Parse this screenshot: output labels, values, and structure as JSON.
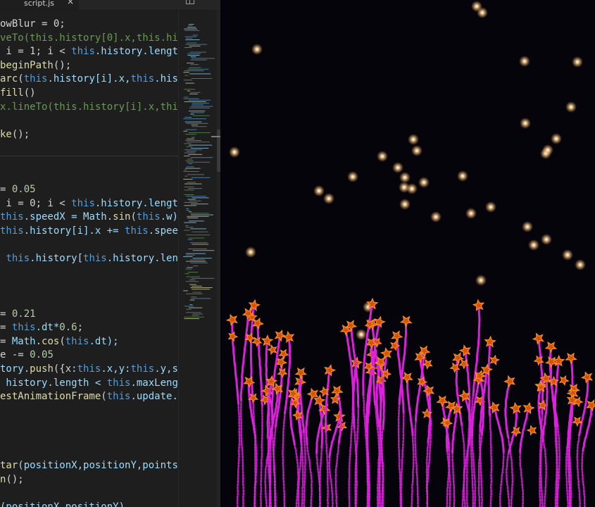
{
  "editor": {
    "tab": {
      "label": "script.js",
      "close_glyph": "×"
    },
    "code_lines": [
      [
        {
          "t": "owBlur = 0;",
          "c": "tk-op"
        }
      ],
      [
        {
          "t": "veTo",
          "c": "tk-cm"
        },
        {
          "t": "(this.history[0].x,this.hi",
          "c": "tk-cm"
        }
      ],
      [
        {
          "t": " i = 1; i < ",
          "c": "tk-op"
        },
        {
          "t": "this",
          "c": "tk-kw"
        },
        {
          "t": ".history.lengt",
          "c": "tk-prop"
        }
      ],
      [
        {
          "t": "beginPath",
          "c": "tk-fn"
        },
        {
          "t": "();",
          "c": "tk-op"
        }
      ],
      [
        {
          "t": "arc",
          "c": "tk-fn"
        },
        {
          "t": "(",
          "c": "tk-op"
        },
        {
          "t": "this",
          "c": "tk-kw"
        },
        {
          "t": ".history[i].x,",
          "c": "tk-prop"
        },
        {
          "t": "this",
          "c": "tk-kw"
        },
        {
          "t": ".his",
          "c": "tk-prop"
        }
      ],
      [
        {
          "t": "fill",
          "c": "tk-fn"
        },
        {
          "t": "()",
          "c": "tk-op"
        }
      ],
      [
        {
          "t": "x.lineTo(this.history[i].x,thi",
          "c": "tk-cm"
        }
      ],
      [
        {
          "t": "",
          "c": "tk-op"
        }
      ],
      [
        {
          "t": "ke",
          "c": "tk-fn"
        },
        {
          "t": "();",
          "c": "tk-op"
        }
      ],
      [
        {
          "t": "",
          "c": "tk-op"
        }
      ],
      [
        {
          "t": "",
          "c": "tk-op"
        }
      ],
      [
        {
          "t": "",
          "c": "tk-op"
        }
      ],
      [
        {
          "t": "= ",
          "c": "tk-op"
        },
        {
          "t": "0.05",
          "c": "tk-num"
        }
      ],
      [
        {
          "t": " i = 0; i < ",
          "c": "tk-op"
        },
        {
          "t": "this",
          "c": "tk-kw"
        },
        {
          "t": ".history.lengt",
          "c": "tk-prop"
        }
      ],
      [
        {
          "t": "this",
          "c": "tk-kw"
        },
        {
          "t": ".speedX = ",
          "c": "tk-prop"
        },
        {
          "t": "Math",
          "c": "tk-prop"
        },
        {
          "t": ".",
          "c": "tk-op"
        },
        {
          "t": "sin",
          "c": "tk-fn"
        },
        {
          "t": "(",
          "c": "tk-op"
        },
        {
          "t": "this",
          "c": "tk-kw"
        },
        {
          "t": ".w)",
          "c": "tk-prop"
        }
      ],
      [
        {
          "t": "this",
          "c": "tk-kw"
        },
        {
          "t": ".history[i].x += ",
          "c": "tk-prop"
        },
        {
          "t": "this",
          "c": "tk-kw"
        },
        {
          "t": ".spee",
          "c": "tk-prop"
        }
      ],
      [
        {
          "t": "",
          "c": "tk-op"
        }
      ],
      [
        {
          "t": " ",
          "c": "tk-op"
        },
        {
          "t": "this",
          "c": "tk-kw"
        },
        {
          "t": ".history[",
          "c": "tk-prop"
        },
        {
          "t": "this",
          "c": "tk-kw"
        },
        {
          "t": ".history.len",
          "c": "tk-prop"
        }
      ],
      [
        {
          "t": "",
          "c": "tk-op"
        }
      ],
      [
        {
          "t": "",
          "c": "tk-op"
        }
      ],
      [
        {
          "t": "",
          "c": "tk-op"
        }
      ],
      [
        {
          "t": "= ",
          "c": "tk-op"
        },
        {
          "t": "0.21",
          "c": "tk-num"
        }
      ],
      [
        {
          "t": "= ",
          "c": "tk-op"
        },
        {
          "t": "this",
          "c": "tk-kw"
        },
        {
          "t": ".dt*",
          "c": "tk-prop"
        },
        {
          "t": "0.6",
          "c": "tk-num"
        },
        {
          "t": ";",
          "c": "tk-op"
        }
      ],
      [
        {
          "t": "= ",
          "c": "tk-op"
        },
        {
          "t": "Math",
          "c": "tk-prop"
        },
        {
          "t": ".",
          "c": "tk-op"
        },
        {
          "t": "cos",
          "c": "tk-fn"
        },
        {
          "t": "(",
          "c": "tk-op"
        },
        {
          "t": "this",
          "c": "tk-kw"
        },
        {
          "t": ".dt);",
          "c": "tk-prop"
        }
      ],
      [
        {
          "t": "e -= ",
          "c": "tk-op"
        },
        {
          "t": "0.05",
          "c": "tk-num"
        }
      ],
      [
        {
          "t": "tory.",
          "c": "tk-prop"
        },
        {
          "t": "push",
          "c": "tk-fn"
        },
        {
          "t": "({x:",
          "c": "tk-op"
        },
        {
          "t": "this",
          "c": "tk-kw"
        },
        {
          "t": ".x,y:",
          "c": "tk-prop"
        },
        {
          "t": "this",
          "c": "tk-kw"
        },
        {
          "t": ".y,s",
          "c": "tk-prop"
        }
      ],
      [
        {
          "t": " history.length < ",
          "c": "tk-prop"
        },
        {
          "t": "this",
          "c": "tk-kw"
        },
        {
          "t": ".maxLeng",
          "c": "tk-prop"
        }
      ],
      [
        {
          "t": "estAnimationFrame",
          "c": "tk-fn"
        },
        {
          "t": "(",
          "c": "tk-op"
        },
        {
          "t": "this",
          "c": "tk-kw"
        },
        {
          "t": ".update.",
          "c": "tk-prop"
        }
      ],
      [
        {
          "t": "",
          "c": "tk-op"
        }
      ],
      [
        {
          "t": "",
          "c": "tk-op"
        }
      ],
      [
        {
          "t": "",
          "c": "tk-op"
        }
      ],
      [
        {
          "t": "",
          "c": "tk-op"
        }
      ],
      [
        {
          "t": "tar",
          "c": "tk-fn"
        },
        {
          "t": "(positionX,positionY,points",
          "c": "tk-prop"
        }
      ],
      [
        {
          "t": "n",
          "c": "tk-fn"
        },
        {
          "t": "();",
          "c": "tk-op"
        }
      ],
      [
        {
          "t": "",
          "c": "tk-op"
        }
      ],
      [
        {
          "t": "(positionX,positionY)",
          "c": "tk-prop"
        }
      ]
    ]
  },
  "icons": {
    "split_editor": "split-editor-icon",
    "tab_close": "close-icon"
  },
  "colors": {
    "editor_bg": "#1e1e1e",
    "canvas_bg": "#04040a",
    "stem": "#e020e0",
    "star_fill": "#d35400",
    "star_stroke": "#ff8a2a",
    "sparkle": "#ffe8c0"
  },
  "canvas": {
    "sparkles": 36,
    "plants": 17
  }
}
